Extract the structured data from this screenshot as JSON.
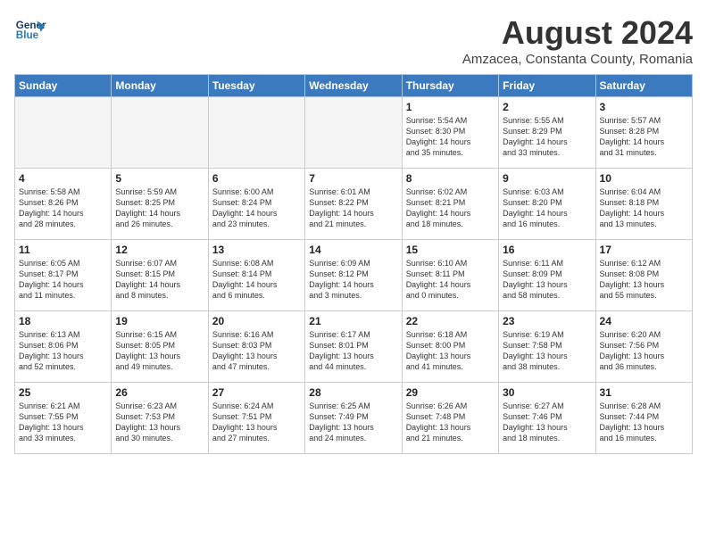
{
  "header": {
    "logo_line1": "General",
    "logo_line2": "Blue",
    "title": "August 2024",
    "subtitle": "Amzacea, Constanta County, Romania"
  },
  "columns": [
    "Sunday",
    "Monday",
    "Tuesday",
    "Wednesday",
    "Thursday",
    "Friday",
    "Saturday"
  ],
  "weeks": [
    [
      {
        "day": "",
        "info": ""
      },
      {
        "day": "",
        "info": ""
      },
      {
        "day": "",
        "info": ""
      },
      {
        "day": "",
        "info": ""
      },
      {
        "day": "1",
        "info": "Sunrise: 5:54 AM\nSunset: 8:30 PM\nDaylight: 14 hours\nand 35 minutes."
      },
      {
        "day": "2",
        "info": "Sunrise: 5:55 AM\nSunset: 8:29 PM\nDaylight: 14 hours\nand 33 minutes."
      },
      {
        "day": "3",
        "info": "Sunrise: 5:57 AM\nSunset: 8:28 PM\nDaylight: 14 hours\nand 31 minutes."
      }
    ],
    [
      {
        "day": "4",
        "info": "Sunrise: 5:58 AM\nSunset: 8:26 PM\nDaylight: 14 hours\nand 28 minutes."
      },
      {
        "day": "5",
        "info": "Sunrise: 5:59 AM\nSunset: 8:25 PM\nDaylight: 14 hours\nand 26 minutes."
      },
      {
        "day": "6",
        "info": "Sunrise: 6:00 AM\nSunset: 8:24 PM\nDaylight: 14 hours\nand 23 minutes."
      },
      {
        "day": "7",
        "info": "Sunrise: 6:01 AM\nSunset: 8:22 PM\nDaylight: 14 hours\nand 21 minutes."
      },
      {
        "day": "8",
        "info": "Sunrise: 6:02 AM\nSunset: 8:21 PM\nDaylight: 14 hours\nand 18 minutes."
      },
      {
        "day": "9",
        "info": "Sunrise: 6:03 AM\nSunset: 8:20 PM\nDaylight: 14 hours\nand 16 minutes."
      },
      {
        "day": "10",
        "info": "Sunrise: 6:04 AM\nSunset: 8:18 PM\nDaylight: 14 hours\nand 13 minutes."
      }
    ],
    [
      {
        "day": "11",
        "info": "Sunrise: 6:05 AM\nSunset: 8:17 PM\nDaylight: 14 hours\nand 11 minutes."
      },
      {
        "day": "12",
        "info": "Sunrise: 6:07 AM\nSunset: 8:15 PM\nDaylight: 14 hours\nand 8 minutes."
      },
      {
        "day": "13",
        "info": "Sunrise: 6:08 AM\nSunset: 8:14 PM\nDaylight: 14 hours\nand 6 minutes."
      },
      {
        "day": "14",
        "info": "Sunrise: 6:09 AM\nSunset: 8:12 PM\nDaylight: 14 hours\nand 3 minutes."
      },
      {
        "day": "15",
        "info": "Sunrise: 6:10 AM\nSunset: 8:11 PM\nDaylight: 14 hours\nand 0 minutes."
      },
      {
        "day": "16",
        "info": "Sunrise: 6:11 AM\nSunset: 8:09 PM\nDaylight: 13 hours\nand 58 minutes."
      },
      {
        "day": "17",
        "info": "Sunrise: 6:12 AM\nSunset: 8:08 PM\nDaylight: 13 hours\nand 55 minutes."
      }
    ],
    [
      {
        "day": "18",
        "info": "Sunrise: 6:13 AM\nSunset: 8:06 PM\nDaylight: 13 hours\nand 52 minutes."
      },
      {
        "day": "19",
        "info": "Sunrise: 6:15 AM\nSunset: 8:05 PM\nDaylight: 13 hours\nand 49 minutes."
      },
      {
        "day": "20",
        "info": "Sunrise: 6:16 AM\nSunset: 8:03 PM\nDaylight: 13 hours\nand 47 minutes."
      },
      {
        "day": "21",
        "info": "Sunrise: 6:17 AM\nSunset: 8:01 PM\nDaylight: 13 hours\nand 44 minutes."
      },
      {
        "day": "22",
        "info": "Sunrise: 6:18 AM\nSunset: 8:00 PM\nDaylight: 13 hours\nand 41 minutes."
      },
      {
        "day": "23",
        "info": "Sunrise: 6:19 AM\nSunset: 7:58 PM\nDaylight: 13 hours\nand 38 minutes."
      },
      {
        "day": "24",
        "info": "Sunrise: 6:20 AM\nSunset: 7:56 PM\nDaylight: 13 hours\nand 36 minutes."
      }
    ],
    [
      {
        "day": "25",
        "info": "Sunrise: 6:21 AM\nSunset: 7:55 PM\nDaylight: 13 hours\nand 33 minutes."
      },
      {
        "day": "26",
        "info": "Sunrise: 6:23 AM\nSunset: 7:53 PM\nDaylight: 13 hours\nand 30 minutes."
      },
      {
        "day": "27",
        "info": "Sunrise: 6:24 AM\nSunset: 7:51 PM\nDaylight: 13 hours\nand 27 minutes."
      },
      {
        "day": "28",
        "info": "Sunrise: 6:25 AM\nSunset: 7:49 PM\nDaylight: 13 hours\nand 24 minutes."
      },
      {
        "day": "29",
        "info": "Sunrise: 6:26 AM\nSunset: 7:48 PM\nDaylight: 13 hours\nand 21 minutes."
      },
      {
        "day": "30",
        "info": "Sunrise: 6:27 AM\nSunset: 7:46 PM\nDaylight: 13 hours\nand 18 minutes."
      },
      {
        "day": "31",
        "info": "Sunrise: 6:28 AM\nSunset: 7:44 PM\nDaylight: 13 hours\nand 16 minutes."
      }
    ]
  ]
}
